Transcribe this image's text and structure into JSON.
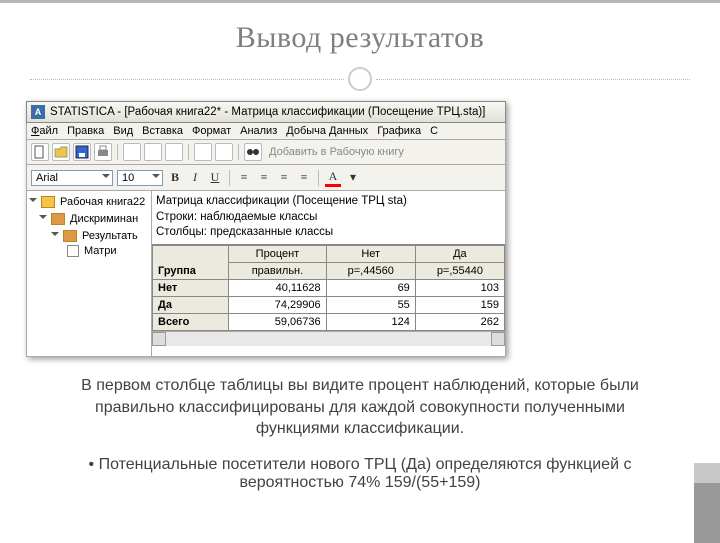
{
  "slide": {
    "title": "Вывод результатов",
    "paragraph1": "В первом столбце таблицы вы видите процент наблюдений, которые были правильно классифицированы для каждой совокупности полученными функциями классификации.",
    "bullet1": "Потенциальные посетители нового ТРЦ (Да) определяются функцией с вероятностью 74%   159/(55+159)"
  },
  "app": {
    "window_title": "STATISTICA - [Рабочая книга22* - Матрица классификации (Посещение ТРЦ.sta)]",
    "app_letter": "A",
    "menu": [
      "Файл",
      "Правка",
      "Вид",
      "Вставка",
      "Формат",
      "Анализ",
      "Добыча Данных",
      "Графика",
      "С"
    ],
    "add_to_workbook": "Добавить в Рабочую книгу",
    "font_name": "Arial",
    "font_size": "10",
    "tree": {
      "root": "Рабочая книга22",
      "node1": "Дискриминан",
      "node2": "Результать",
      "node3": "Матри"
    },
    "grid_header": {
      "l1": "Матрица классификации (Посещение ТРЦ sta)",
      "l2": "Строки: наблюдаемые классы",
      "l3": "Столбцы: предсказанные классы"
    },
    "columns": {
      "c0": "Группа",
      "c1a": "Процент",
      "c1b": "правильн.",
      "c2a": "Нет",
      "c2b": "p=,44560",
      "c3a": "Да",
      "c3b": "p=,55440"
    },
    "rows": [
      {
        "label": "Нет",
        "pct": "40,11628",
        "no": "69",
        "yes": "103"
      },
      {
        "label": "Да",
        "pct": "74,29906",
        "no": "55",
        "yes": "159"
      },
      {
        "label": "Всего",
        "pct": "59,06736",
        "no": "124",
        "yes": "262"
      }
    ]
  },
  "chart_data": {
    "type": "table",
    "title": "Матрица классификации (Посещение ТРЦ sta)",
    "rows_label": "Строки: наблюдаемые классы",
    "cols_label": "Столбцы: предсказанные классы",
    "columns": [
      "Группа",
      "Процент правильн.",
      "Нет p=,44560",
      "Да p=,55440"
    ],
    "data": [
      [
        "Нет",
        40.11628,
        69,
        103
      ],
      [
        "Да",
        74.29906,
        55,
        159
      ],
      [
        "Всего",
        59.06736,
        124,
        262
      ]
    ]
  }
}
